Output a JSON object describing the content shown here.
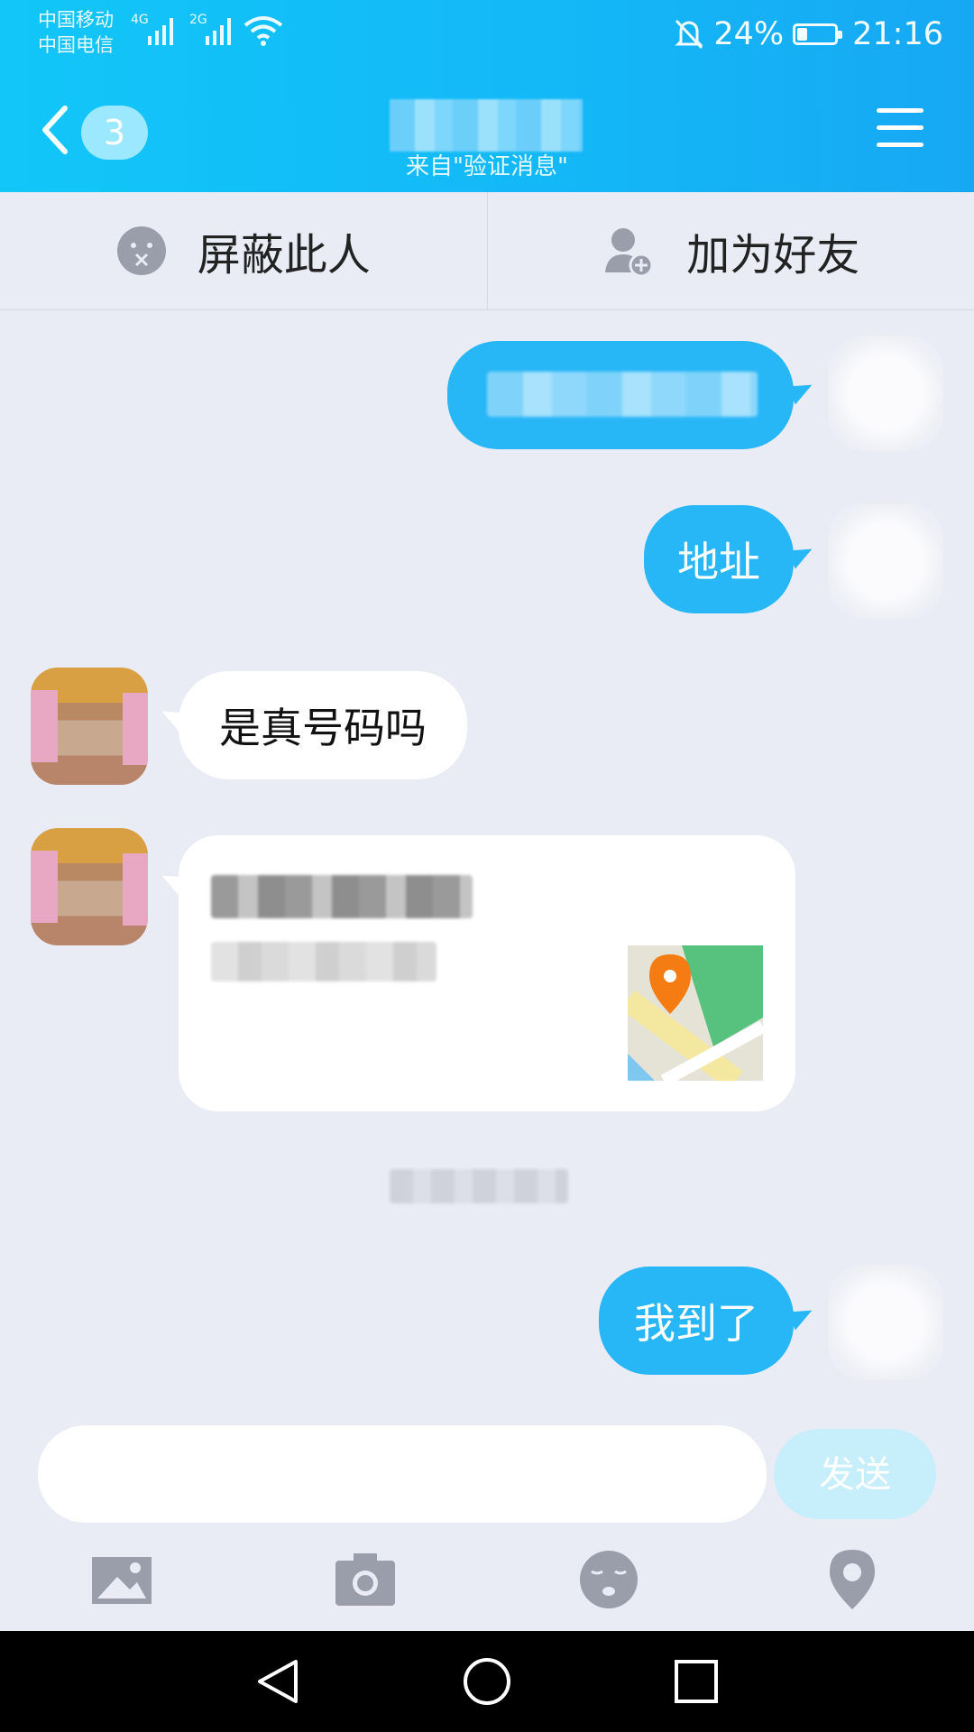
{
  "status_bar": {
    "carrier1": "中国移动",
    "carrier2": "中国电信",
    "net1": "4G",
    "net2": "2G",
    "battery": "24%",
    "time": "21:16"
  },
  "header": {
    "unread_count": "3",
    "subtitle": "来自\"验证消息\""
  },
  "actions": {
    "block_label": "屏蔽此人",
    "add_friend_label": "加为好友"
  },
  "messages": [
    {
      "side": "right",
      "text": ""
    },
    {
      "side": "right",
      "text": "地址"
    },
    {
      "side": "left",
      "text": "是真号码吗"
    },
    {
      "side": "left",
      "type": "location"
    },
    {
      "side": "right",
      "text": "我到了"
    }
  ],
  "composer": {
    "placeholder": "",
    "send_label": "发送"
  },
  "colors": {
    "header": "#13b7f6",
    "bubble_out": "#27b6f6",
    "bubble_in": "#ffffff",
    "background": "#e9ecf5"
  }
}
